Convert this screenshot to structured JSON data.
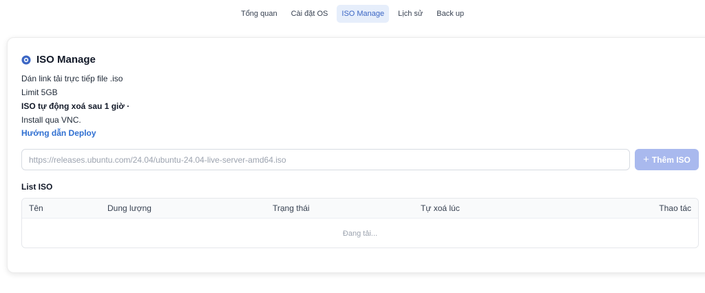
{
  "nav": {
    "tabs": [
      {
        "label": "Tổng quan",
        "active": false
      },
      {
        "label": "Cài đặt OS",
        "active": false
      },
      {
        "label": "ISO Manage",
        "active": true
      },
      {
        "label": "Lịch sử",
        "active": false
      },
      {
        "label": "Back up",
        "active": false
      }
    ]
  },
  "card": {
    "title": "ISO Manage",
    "title_icon": "disc-icon",
    "info": {
      "line1": "Dán link tải trực tiếp file .iso",
      "line2": "Limit 5GB",
      "line3": "ISO tự động xoá sau 1 giờ ·",
      "line4": "Install qua VNC.",
      "link": "Hướng dẫn Deploy"
    },
    "url_input": {
      "placeholder": "https://releases.ubuntu.com/24.04/ubuntu-24.04-live-server-amd64.iso",
      "value": ""
    },
    "add_button": {
      "label": "Thêm ISO",
      "icon": "plus-icon"
    },
    "list": {
      "title": "List ISO",
      "columns": [
        "Tên",
        "Dung lượng",
        "Trạng thái",
        "Tự xoá lúc",
        "Thao tác"
      ],
      "loading_text": "Đang tải..."
    }
  },
  "colors": {
    "accent": "#2f6fd1",
    "active_tab_bg": "#e6eefb",
    "button_bg": "#a9b9ee"
  }
}
